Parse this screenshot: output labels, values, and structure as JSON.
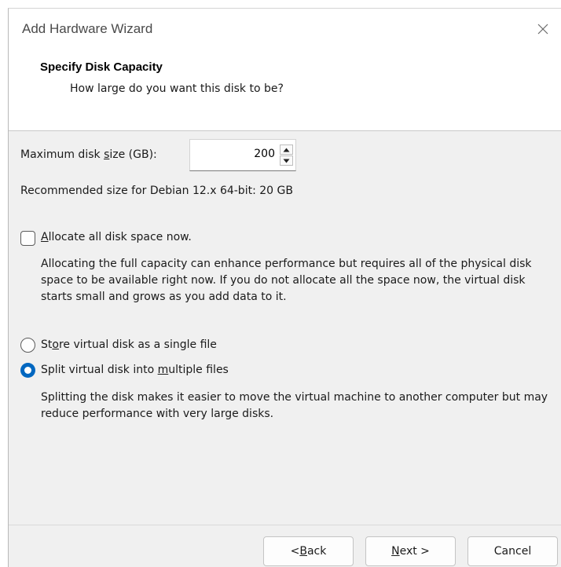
{
  "window": {
    "title": "Add Hardware Wizard"
  },
  "header": {
    "title": "Specify Disk Capacity",
    "subtitle": "How large do you want this disk to be?"
  },
  "disk_size": {
    "label_pre": "Maximum disk ",
    "label_mnemonic": "s",
    "label_post": "ize (GB):",
    "value": "200"
  },
  "recommended": "Recommended size for Debian 12.x 64-bit: 20 GB",
  "allocate": {
    "checked": false,
    "label_mnemonic": "A",
    "label_post": "llocate all disk space now.",
    "description": "Allocating the full capacity can enhance performance but requires all of the physical disk space to be available right now. If you do not allocate all the space now, the virtual disk starts small and grows as you add data to it."
  },
  "storage_options": [
    {
      "label_pre": "St",
      "label_mnemonic": "o",
      "label_post": "re virtual disk as a single file",
      "selected": false
    },
    {
      "label_pre": "Split virtual disk into ",
      "label_mnemonic": "m",
      "label_post": "ultiple files",
      "selected": true
    }
  ],
  "split_description": "Splitting the disk makes it easier to move the virtual machine to another computer but may reduce performance with very large disks.",
  "buttons": {
    "back_pre": "< ",
    "back_mnemonic": "B",
    "back_post": "ack",
    "next_mnemonic": "N",
    "next_post": "ext >",
    "cancel": "Cancel"
  },
  "colors": {
    "accent": "#0067c0",
    "dialog_bg": "#f0f0f0",
    "header_bg": "#ffffff"
  },
  "icons": {
    "close": "close-icon",
    "spin_up": "spin-up-icon",
    "spin_down": "spin-down-icon"
  }
}
